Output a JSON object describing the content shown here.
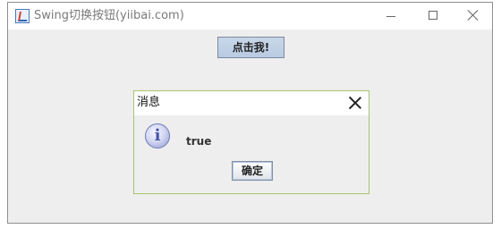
{
  "window": {
    "title": "Swing切换按钮(yiibai.com)",
    "controls": {
      "minimize_icon": "minimize-icon",
      "maximize_icon": "maximize-icon",
      "close_icon": "close-icon"
    }
  },
  "main": {
    "button_label": "点击我!"
  },
  "dialog": {
    "title": "消息",
    "message": "true",
    "ok_label": "确定",
    "icon": "info-icon"
  }
}
